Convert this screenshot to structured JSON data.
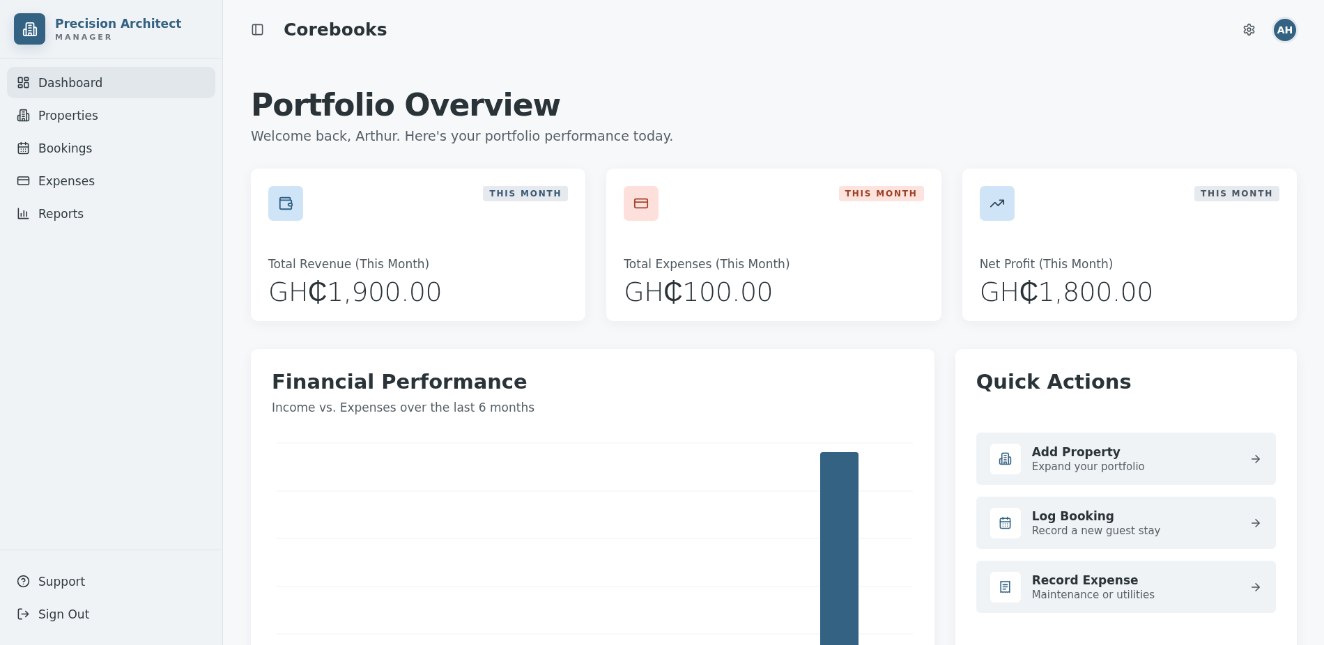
{
  "sidebar": {
    "brand": {
      "name": "Precision Architect",
      "subtitle": "MANAGER"
    },
    "items": [
      {
        "label": "Dashboard",
        "kind": "dashboard",
        "selected": true
      },
      {
        "label": "Properties",
        "kind": "building",
        "selected": false
      },
      {
        "label": "Bookings",
        "kind": "calendar",
        "selected": false
      },
      {
        "label": "Expenses",
        "kind": "card",
        "selected": false
      },
      {
        "label": "Reports",
        "kind": "chart",
        "selected": false
      }
    ],
    "footer_items": [
      {
        "label": "Support",
        "kind": "help"
      },
      {
        "label": "Sign Out",
        "kind": "logout"
      }
    ]
  },
  "header": {
    "title": "Corebooks",
    "avatar": "AH"
  },
  "page": {
    "title": "Portfolio Overview",
    "subtitle": "Welcome back, Arthur. Here's your portfolio performance today."
  },
  "stats": [
    {
      "kind": "revenue",
      "badge": "THIS MONTH",
      "label": "Total Revenue (This Month)",
      "value": "GH₵1,900.00"
    },
    {
      "kind": "expense",
      "badge": "THIS MONTH",
      "label": "Total Expenses (This Month)",
      "value": "GH₵100.00"
    },
    {
      "kind": "profit",
      "badge": "THIS MONTH",
      "label": "Net Profit (This Month)",
      "value": "GH₵1,800.00"
    }
  ],
  "financial_performance": {
    "title": "Financial Performance",
    "subtitle": "Income vs. Expenses over the last 6 months"
  },
  "quick_actions": {
    "title": "Quick Actions",
    "items": [
      {
        "kind": "building",
        "title": "Add Property",
        "subtitle": "Expand your portfolio"
      },
      {
        "kind": "calendar",
        "title": "Log Booking",
        "subtitle": "Record a new guest stay"
      },
      {
        "kind": "receipt",
        "title": "Record Expense",
        "subtitle": "Maintenance or utilities"
      }
    ]
  }
}
